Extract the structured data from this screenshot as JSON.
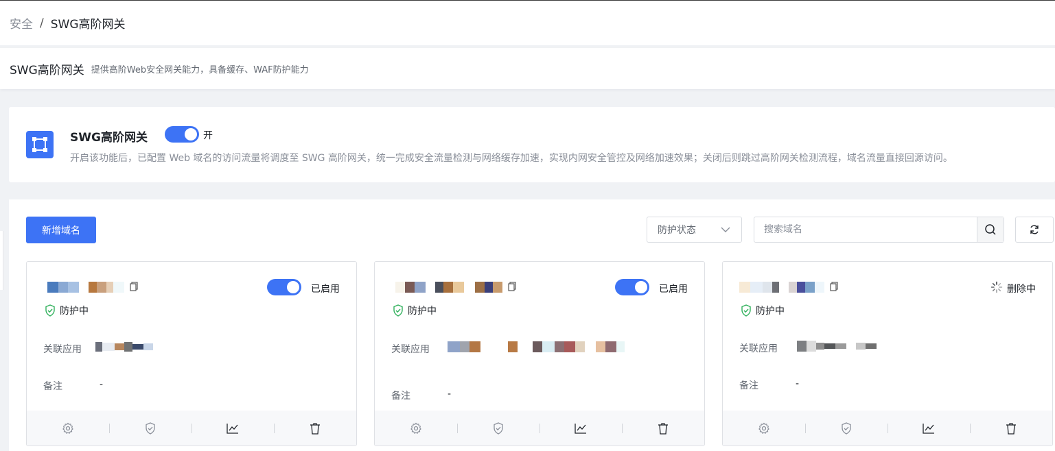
{
  "breadcrumb": {
    "parent": "安全",
    "separator": "/",
    "current": "SWG高阶网关"
  },
  "header": {
    "title": "SWG高阶网关",
    "description": "提供高阶Web安全网关能力，具备缓存、WAF防护能力"
  },
  "feature": {
    "title": "SWG高阶网关",
    "toggle_state": "开",
    "description": "开启该功能后，已配置 Web 域名的访问流量将调度至 SWG 高阶网关，统一完成安全流量检测与网络缓存加速，实现内网安全管控及网络加速效果；关闭后则跳过高阶网关检测流程，域名流量直接回源访问。"
  },
  "toolbar": {
    "add_label": "新增域名",
    "status_filter": "防护状态",
    "search_placeholder": "搜索域名"
  },
  "cards": [
    {
      "state": "已启用",
      "protection": "防护中",
      "app_label": "关联应用",
      "note_label": "备注",
      "note_value": "-"
    },
    {
      "state": "已启用",
      "protection": "防护中",
      "app_label": "关联应用",
      "note_label": "备注",
      "note_value": "-"
    },
    {
      "state": "删除中",
      "protection": "防护中",
      "app_label": "关联应用",
      "note_label": "备注",
      "note_value": "-"
    }
  ],
  "colors": {
    "primary": "#3d73f5",
    "success": "#2fb05b"
  },
  "icons": [
    "copy-icon",
    "shield-check-icon",
    "gear-icon",
    "shield-icon",
    "chart-icon",
    "trash-icon",
    "search-icon",
    "refresh-icon",
    "chevron-down-icon",
    "loading-icon",
    "selection-frame-icon"
  ]
}
